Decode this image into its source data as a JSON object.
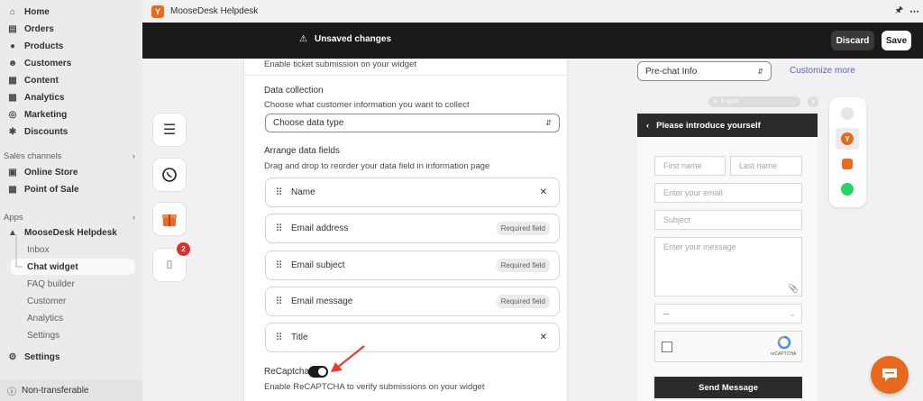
{
  "sidebar": {
    "main_items": [
      {
        "label": "Home",
        "icon": "home-icon"
      },
      {
        "label": "Orders",
        "icon": "orders-icon"
      },
      {
        "label": "Products",
        "icon": "products-icon"
      },
      {
        "label": "Customers",
        "icon": "customers-icon"
      },
      {
        "label": "Content",
        "icon": "content-icon"
      },
      {
        "label": "Analytics",
        "icon": "analytics-icon"
      },
      {
        "label": "Marketing",
        "icon": "marketing-icon"
      },
      {
        "label": "Discounts",
        "icon": "discounts-icon"
      }
    ],
    "sales_channels_heading": "Sales channels",
    "sales_channels": [
      {
        "label": "Online Store",
        "icon": "store-icon"
      },
      {
        "label": "Point of Sale",
        "icon": "pos-icon"
      }
    ],
    "apps_heading": "Apps",
    "app_name": "MooseDesk Helpdesk",
    "app_subitems": [
      "Inbox",
      "Chat widget",
      "FAQ builder",
      "Customer",
      "Analytics",
      "Settings"
    ],
    "settings_label": "Settings",
    "non_transferable_label": "Non-transferable"
  },
  "topbar": {
    "app_title": "MooseDesk Helpdesk"
  },
  "unsaved_bar": {
    "message": "Unsaved changes",
    "discard_label": "Discard",
    "save_label": "Save"
  },
  "icon_cards": {
    "bell_badge": "2"
  },
  "form": {
    "top_text": "Enable ticket submission on your widget",
    "data_collection_label": "Data collection",
    "data_collection_help": "Choose what customer information you want to collect",
    "data_type_placeholder": "Choose data type",
    "arrange_label": "Arrange data fields",
    "arrange_help": "Drag and drop to reorder your data field in information page",
    "fields": [
      {
        "name": "Name",
        "tag": "",
        "removable": true
      },
      {
        "name": "Email address",
        "tag": "Required field",
        "removable": false
      },
      {
        "name": "Email subject",
        "tag": "Required field",
        "removable": false
      },
      {
        "name": "Email message",
        "tag": "Required field",
        "removable": false
      },
      {
        "name": "Title",
        "tag": "",
        "removable": true
      }
    ],
    "recaptcha_label": "ReCaptcha",
    "recaptcha_enabled": true,
    "recaptcha_help": "Enable ReCAPTCHA to verify submissions on your widget"
  },
  "preview": {
    "select_value": "Pre-chat Info",
    "customize_link": "Customize more",
    "language": "English",
    "header_title": "Please introduce yourself",
    "first_name_ph": "First name",
    "last_name_ph": "Last name",
    "email_ph": "Enter your email",
    "subject_ph": "Subject",
    "message_ph": "Enter your message",
    "dropdown_value": "--",
    "recaptcha_text": "reCAPTCHA",
    "send_label": "Send Message"
  },
  "colors": {
    "accent_orange": "#e86a1f",
    "link_blue": "#5a5fd6",
    "dark_bar": "#1a1a1a",
    "whatsapp_green": "#25d366"
  }
}
